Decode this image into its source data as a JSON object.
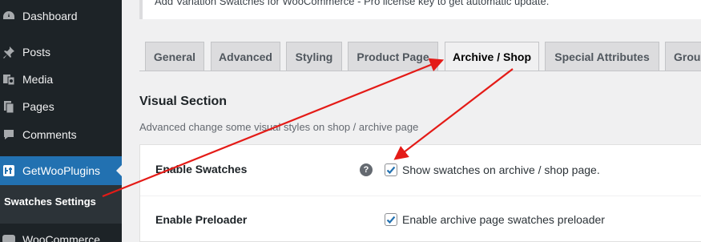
{
  "sidebar": {
    "items": [
      {
        "label": "Dashboard",
        "icon": "dashboard-icon"
      },
      {
        "label": "Posts",
        "icon": "pin-icon"
      },
      {
        "label": "Media",
        "icon": "media-icon"
      },
      {
        "label": "Pages",
        "icon": "pages-icon"
      },
      {
        "label": "Comments",
        "icon": "comments-icon"
      },
      {
        "label": "GetWooPlugins",
        "icon": "getwooplugins-icon"
      },
      {
        "label": "WooCommerce",
        "icon": "woo-icon"
      }
    ],
    "submenu": {
      "label": "Swatches Settings"
    }
  },
  "notice": {
    "text": "Add Variation Swatches for WooCommerce - Pro license key to get automatic update."
  },
  "tabs": [
    {
      "label": "General"
    },
    {
      "label": "Advanced"
    },
    {
      "label": "Styling"
    },
    {
      "label": "Product Page"
    },
    {
      "label": "Archive / Shop"
    },
    {
      "label": "Special Attributes"
    },
    {
      "label": "Group"
    }
  ],
  "active_tab": "Archive / Shop",
  "section": {
    "title": "Visual Section",
    "description": "Advanced change some visual styles on shop / archive page"
  },
  "settings": [
    {
      "label": "Enable Swatches",
      "checkbox_label": "Show swatches on archive / shop page.",
      "checked": true,
      "help_icon": "?"
    },
    {
      "label": "Enable Preloader",
      "checkbox_label": "Enable archive page swatches preloader",
      "checked": true
    }
  ],
  "colors": {
    "sidebar_bg": "#1d2327",
    "accent": "#2271b1",
    "arrow": "#e41b17"
  }
}
